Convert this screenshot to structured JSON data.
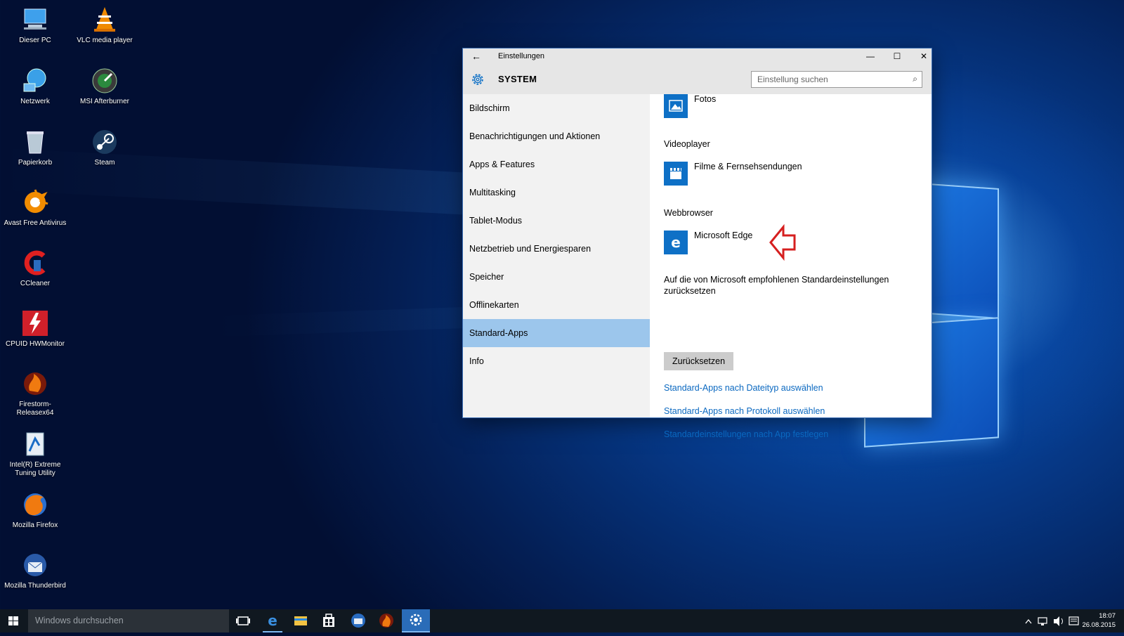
{
  "desktop": {
    "icons": [
      {
        "label": "Dieser PC",
        "icon": "computer-icon"
      },
      {
        "label": "VLC media player",
        "icon": "vlc-cone-icon"
      },
      {
        "label": "Netzwerk",
        "icon": "network-globe-icon"
      },
      {
        "label": "MSI Afterburner",
        "icon": "msi-afterburner-icon"
      },
      {
        "label": "Papierkorb",
        "icon": "recycle-bin-icon"
      },
      {
        "label": "Steam",
        "icon": "steam-icon"
      },
      {
        "label": "Avast Free Antivirus",
        "icon": "avast-icon"
      },
      {
        "label": "CCleaner",
        "icon": "ccleaner-icon"
      },
      {
        "label": "CPUID HWMonitor",
        "icon": "hwmonitor-icon"
      },
      {
        "label": "Firestorm-Releasex64",
        "icon": "firestorm-icon"
      },
      {
        "label": "Intel(R) Extreme Tuning Utility",
        "icon": "intel-xtu-icon"
      },
      {
        "label": "Mozilla Firefox",
        "icon": "firefox-icon"
      },
      {
        "label": "Mozilla Thunderbird",
        "icon": "thunderbird-icon"
      }
    ]
  },
  "window": {
    "title": "Einstellungen",
    "back_glyph": "←",
    "minimize_glyph": "—",
    "maximize_glyph": "☐",
    "close_glyph": "✕",
    "section": "SYSTEM",
    "search_placeholder": "Einstellung suchen",
    "search_glyph": "⌕"
  },
  "nav": {
    "items": [
      {
        "label": "Bildschirm"
      },
      {
        "label": "Benachrichtigungen und Aktionen"
      },
      {
        "label": "Apps & Features"
      },
      {
        "label": "Multitasking"
      },
      {
        "label": "Tablet-Modus"
      },
      {
        "label": "Netzbetrieb und Energiesparen"
      },
      {
        "label": "Speicher"
      },
      {
        "label": "Offlinekarten"
      },
      {
        "label": "Standard-Apps"
      },
      {
        "label": "Info"
      }
    ],
    "selected": "Standard-Apps",
    "selected_color": "#9cc6ec"
  },
  "content": {
    "photos_app": "Fotos",
    "videoplayer_heading": "Videoplayer",
    "videoplayer_app": "Filme & Fernsehsendungen",
    "webbrowser_heading": "Webbrowser",
    "webbrowser_app": "Microsoft Edge",
    "reset_text": "Auf die von Microsoft empfohlenen Standardeinstellungen zurücksetzen",
    "reset_button": "Zurücksetzen",
    "links": [
      "Standard-Apps nach Dateityp auswählen",
      "Standard-Apps nach Protokoll auswählen",
      "Standardeinstellungen nach App festlegen"
    ],
    "accent_color": "#0e70c6",
    "link_color": "#0a68c0",
    "annotation_arrow_color": "#d61f1f"
  },
  "taskbar": {
    "search_placeholder": "Windows durchsuchen",
    "time": "18:07",
    "date": "26.08.2015",
    "apps": [
      "task-view-icon",
      "edge-icon",
      "file-explorer-icon",
      "store-icon",
      "thunderbird-icon",
      "firestorm-icon",
      "settings-icon"
    ],
    "active_app": "settings-icon"
  }
}
